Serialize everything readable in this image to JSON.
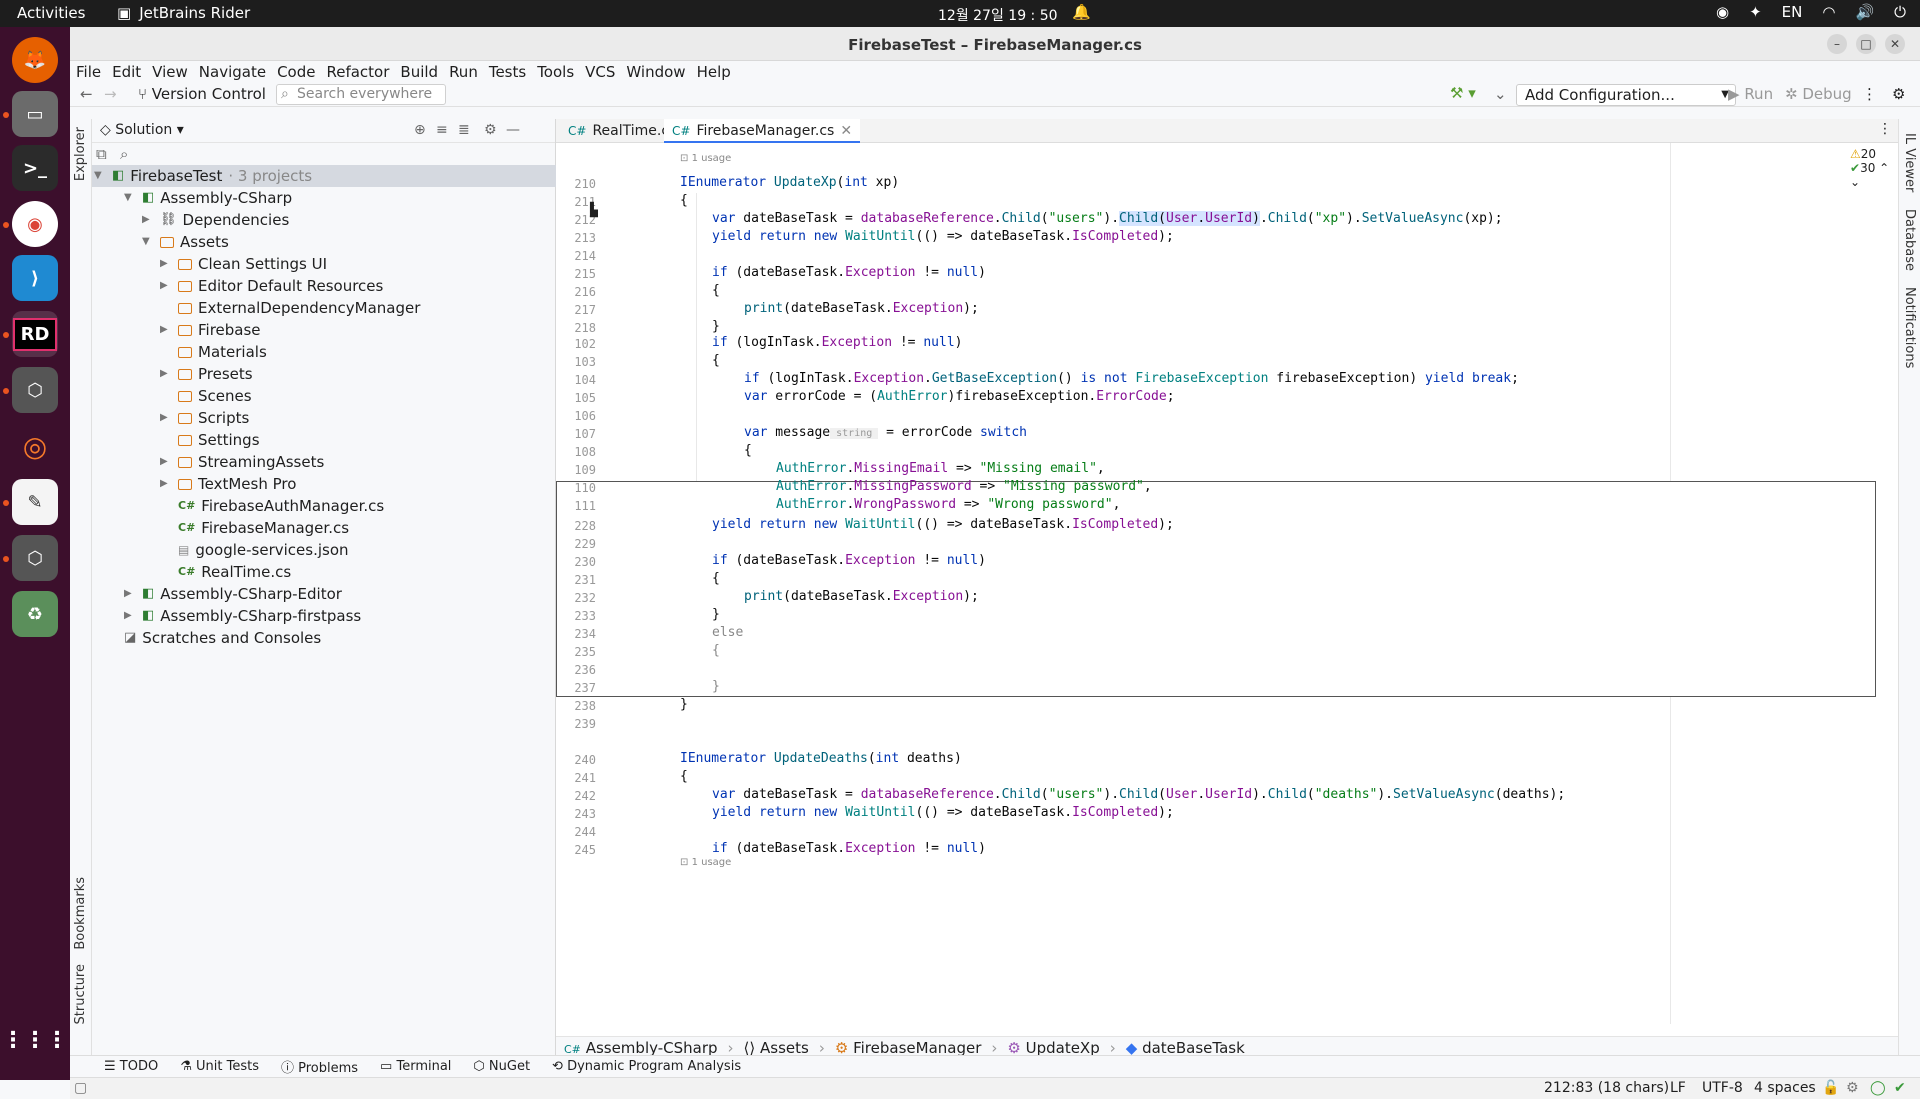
{
  "topbar": {
    "activities": "Activities",
    "app_name": "JetBrains Rider",
    "clock": "12월 27일  19 : 50",
    "lang": "EN"
  },
  "window": {
    "title": "FirebaseTest – FirebaseManager.cs"
  },
  "menu": [
    "File",
    "Edit",
    "View",
    "Navigate",
    "Code",
    "Refactor",
    "Build",
    "Run",
    "Tests",
    "Tools",
    "VCS",
    "Window",
    "Help"
  ],
  "toolbar": {
    "vcs": "Version Control",
    "search_placeholder": "Search everywhere",
    "config": "Add Configuration...",
    "run": "Run",
    "debug": "Debug"
  },
  "explorer": {
    "title": "Solution",
    "strip_top": "Explorer",
    "strip_b1": "Bookmarks",
    "strip_b2": "Structure",
    "root": {
      "name": "FirebaseTest",
      "meta": "· 3 projects"
    },
    "items": [
      {
        "label": "Assembly-CSharp",
        "level": 1,
        "icon": "proj",
        "arrow": "down"
      },
      {
        "label": "Dependencies",
        "level": 2,
        "icon": "dep",
        "arrow": "right"
      },
      {
        "label": "Assets",
        "level": 2,
        "icon": "folder",
        "arrow": "down"
      },
      {
        "label": "Clean Settings UI",
        "level": 3,
        "icon": "folder",
        "arrow": "right"
      },
      {
        "label": "Editor Default Resources",
        "level": 3,
        "icon": "folder",
        "arrow": "right"
      },
      {
        "label": "ExternalDependencyManager",
        "level": 3,
        "icon": "folder",
        "arrow": ""
      },
      {
        "label": "Firebase",
        "level": 3,
        "icon": "folder",
        "arrow": "right"
      },
      {
        "label": "Materials",
        "level": 3,
        "icon": "folder",
        "arrow": ""
      },
      {
        "label": "Presets",
        "level": 3,
        "icon": "folder",
        "arrow": "right"
      },
      {
        "label": "Scenes",
        "level": 3,
        "icon": "folder",
        "arrow": ""
      },
      {
        "label": "Scripts",
        "level": 3,
        "icon": "folder",
        "arrow": "right"
      },
      {
        "label": "Settings",
        "level": 3,
        "icon": "folder",
        "arrow": ""
      },
      {
        "label": "StreamingAssets",
        "level": 3,
        "icon": "folder",
        "arrow": "right"
      },
      {
        "label": "TextMesh Pro",
        "level": 3,
        "icon": "folder",
        "arrow": "right"
      },
      {
        "label": "FirebaseAuthManager.cs",
        "level": 3,
        "icon": "cs",
        "arrow": ""
      },
      {
        "label": "FirebaseManager.cs",
        "level": 3,
        "icon": "cs",
        "arrow": ""
      },
      {
        "label": "google-services.json",
        "level": 3,
        "icon": "json",
        "arrow": ""
      },
      {
        "label": "RealTime.cs",
        "level": 3,
        "icon": "cs",
        "arrow": ""
      },
      {
        "label": "Assembly-CSharp-Editor",
        "level": 1,
        "icon": "proj",
        "arrow": "right"
      },
      {
        "label": "Assembly-CSharp-firstpass",
        "level": 1,
        "icon": "proj",
        "arrow": "right"
      },
      {
        "label": "Scratches and Consoles",
        "level": 0,
        "icon": "scratch",
        "arrow": ""
      }
    ]
  },
  "tabs": [
    {
      "label": "RealTime.cs",
      "icon": "C#"
    },
    {
      "label": "FirebaseManager.cs",
      "icon": "C#"
    }
  ],
  "editor": {
    "warnings": "20",
    "ok": "30",
    "usage1": "1 usage",
    "usage2": "1 usage"
  },
  "right_strip": [
    "IL Viewer",
    "Database",
    "Notifications"
  ],
  "breadcrumb": [
    "Assembly-CSharp",
    "Assets",
    "FirebaseManager",
    "UpdateXp",
    "dateBaseTask"
  ],
  "bottom_tabs": [
    "TODO",
    "Unit Tests",
    "Problems",
    "Terminal",
    "NuGet",
    "Dynamic Program Analysis"
  ],
  "status": {
    "pos": "212:83 (18 chars)",
    "le": "LF",
    "enc": "UTF-8",
    "indent": "4 spaces"
  }
}
